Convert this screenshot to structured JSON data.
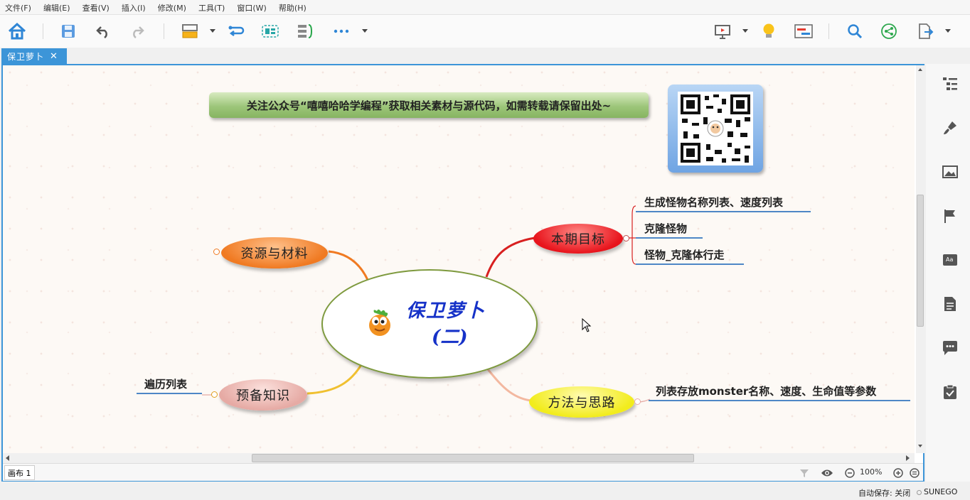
{
  "menu": [
    "文件(F)",
    "编辑(E)",
    "查看(V)",
    "插入(I)",
    "修改(M)",
    "工具(T)",
    "窗口(W)",
    "帮助(H)"
  ],
  "toolbar_icons": [
    "home-icon",
    "save-icon",
    "undo-icon",
    "redo-icon",
    "topic-style-icon",
    "relationship-icon",
    "boundary-icon",
    "summary-icon",
    "more-icon",
    "presentation-icon",
    "idea-icon",
    "gantt-icon",
    "search-icon",
    "share-icon",
    "export-icon"
  ],
  "document": {
    "tab_title": "保卫萝卜",
    "close_glyph": "✕"
  },
  "mindmap": {
    "banner": "关注公众号“嘻嘻哈哈学编程”获取相关素材与源代码，如需转载请保留出处~",
    "central": {
      "title": "保卫萝卜",
      "subtitle": "(二)"
    },
    "topics": {
      "goal": "本期目标",
      "resources": "资源与材料",
      "method": "方法与思路",
      "prereq": "预备知识"
    },
    "goal_items": [
      "生成怪物名称列表、速度列表",
      "克隆怪物",
      "怪物_克隆体行走"
    ],
    "method_items": [
      "列表存放monster名称、速度、生命值等参数"
    ],
    "prereq_items": [
      "遍历列表"
    ],
    "colors": {
      "goal": "#e8141c",
      "resources": "#f07a22",
      "method": "#f2ec1c",
      "prereq": "#e6aaa4",
      "central_border": "#7e9a3e",
      "central_text": "#1632c8",
      "leaf_line": "#4e87c6"
    }
  },
  "status": {
    "sheet": "画布 1",
    "zoom": "100%",
    "autosave": "自动保存: 关闭",
    "brand": "SUNEGO"
  },
  "right_panel_icons": [
    "outline-icon",
    "format-brush-icon",
    "image-icon",
    "marker-flag-icon",
    "text-style-icon",
    "notes-icon",
    "comment-icon",
    "task-icon"
  ]
}
